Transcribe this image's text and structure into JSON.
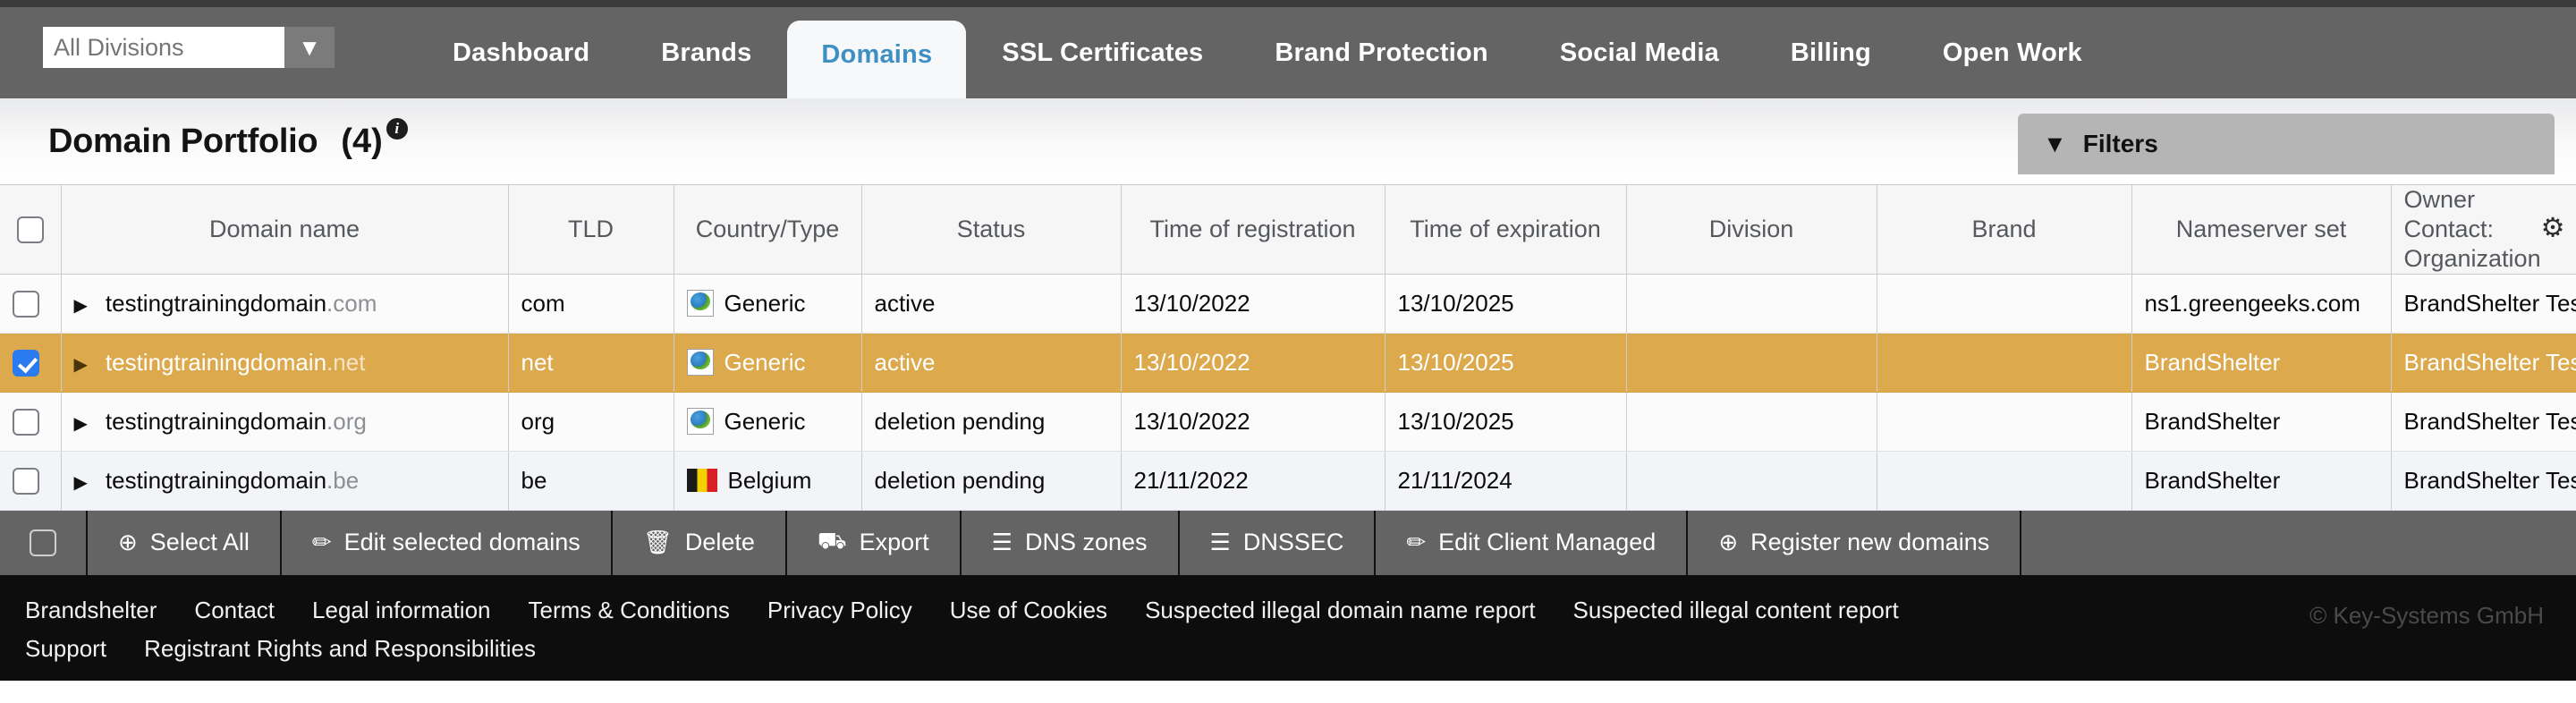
{
  "topbar": {
    "division_filter": {
      "value": "",
      "placeholder": "All Divisions",
      "caret_icon": "▼"
    },
    "nav": [
      {
        "label": "Dashboard",
        "active": false
      },
      {
        "label": "Brands",
        "active": false
      },
      {
        "label": "Domains",
        "active": true
      },
      {
        "label": "SSL Certificates",
        "active": false
      },
      {
        "label": "Brand Protection",
        "active": false
      },
      {
        "label": "Social Media",
        "active": false
      },
      {
        "label": "Billing",
        "active": false
      },
      {
        "label": "Open Work",
        "active": false
      }
    ]
  },
  "pagehead": {
    "title": "Domain Portfolio",
    "count": "(4)",
    "info_icon": "i",
    "filters": {
      "label": "Filters",
      "caret": "▼"
    }
  },
  "table": {
    "columns": [
      "Domain name",
      "TLD",
      "Country/Type",
      "Status",
      "Time of registration",
      "Time of expiration",
      "Division",
      "Brand",
      "Nameserver set",
      "Owner Contact: Organization"
    ],
    "settings_icon": "⚙",
    "rows": [
      {
        "selected": false,
        "name_main": "testingtrainingdomain",
        "name_tld": ".com",
        "tld": "com",
        "country_type": "Generic",
        "flag": "globe",
        "status": "active",
        "registered": "13/10/2022",
        "expires": "13/10/2025",
        "division": "",
        "brand": "",
        "nameserver": "ns1.greengeeks.com",
        "owner": "BrandShelter Test/..."
      },
      {
        "selected": true,
        "name_main": "testingtrainingdomain",
        "name_tld": ".net",
        "tld": "net",
        "country_type": "Generic",
        "flag": "globe",
        "status": "active",
        "registered": "13/10/2022",
        "expires": "13/10/2025",
        "division": "",
        "brand": "",
        "nameserver": "BrandShelter",
        "owner": "BrandShelter Test/..."
      },
      {
        "selected": false,
        "name_main": "testingtrainingdomain",
        "name_tld": ".org",
        "tld": "org",
        "country_type": "Generic",
        "flag": "globe",
        "status": "deletion pending",
        "registered": "13/10/2022",
        "expires": "13/10/2025",
        "division": "",
        "brand": "",
        "nameserver": "BrandShelter",
        "owner": "BrandShelter Test/..."
      },
      {
        "selected": false,
        "name_main": "testingtrainingdomain",
        "name_tld": ".be",
        "tld": "be",
        "country_type": "Belgium",
        "flag": "belgium",
        "status": "deletion pending",
        "registered": "21/11/2022",
        "expires": "21/11/2024",
        "division": "",
        "brand": "",
        "nameserver": "BrandShelter",
        "owner": "BrandShelter Test/..."
      }
    ]
  },
  "actionbar": {
    "buttons": [
      {
        "label": "Select All",
        "icon": "⊕",
        "name": "select-all-button"
      },
      {
        "label": "Edit selected domains",
        "icon": "✏",
        "name": "edit-selected-domains-button"
      },
      {
        "label": "Delete",
        "icon": "🗑",
        "name": "delete-button"
      },
      {
        "label": "Export",
        "icon": "⛟",
        "name": "export-button"
      },
      {
        "label": "DNS zones",
        "icon": "☰",
        "name": "dns-zones-button"
      },
      {
        "label": "DNSSEC",
        "icon": "☰",
        "name": "dnssec-button"
      },
      {
        "label": "Edit Client Managed",
        "icon": "✏",
        "name": "edit-client-managed-button"
      },
      {
        "label": "Register new domains",
        "icon": "⊕",
        "name": "register-new-domains-button"
      }
    ]
  },
  "footer": {
    "links_row1": [
      "Brandshelter",
      "Contact",
      "Legal information",
      "Terms & Conditions",
      "Privacy Policy",
      "Use of Cookies",
      "Suspected illegal domain name report",
      "Suspected illegal content report"
    ],
    "links_row2": [
      "Support",
      "Registrant Rights and Responsibilities"
    ],
    "copyright": "© Key-Systems GmbH"
  },
  "colors": {
    "nav_bg": "#646464",
    "nav_top_strip": "#3b3b3b",
    "active_tab_text": "#3d8fc4",
    "selected_row": "#dda94d",
    "checkbox_checked": "#2a7bf0",
    "footer_bg": "#0d0d0d",
    "filters_bg": "#b5b5b5"
  }
}
